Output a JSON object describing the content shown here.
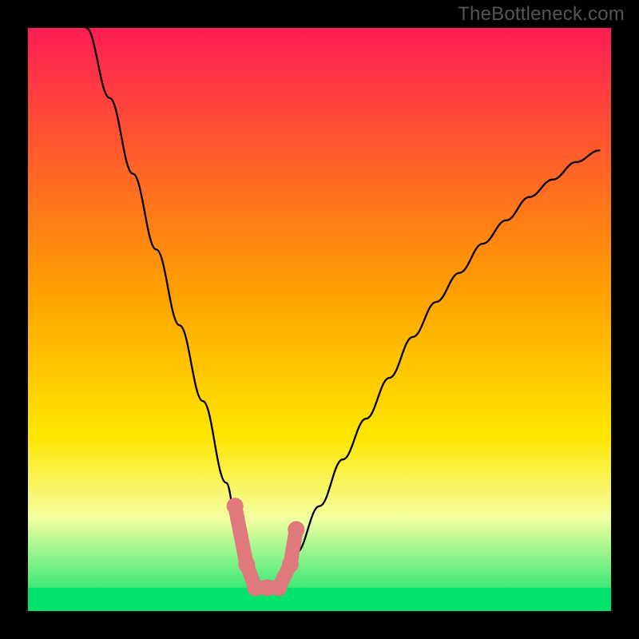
{
  "watermark": "TheBottleneck.com",
  "chart_data": {
    "type": "line",
    "title": "",
    "xlabel": "",
    "ylabel": "",
    "xlim": [
      0,
      100
    ],
    "ylim": [
      0,
      100
    ],
    "grid": false,
    "background_gradient": {
      "top": "#ff1d55",
      "mid": "#ffd200",
      "bottom": "#00e36b"
    },
    "series": [
      {
        "name": "bottleneck-curve",
        "color": "#000000",
        "x": [
          10,
          14,
          18,
          22,
          26,
          30,
          34,
          36,
          38,
          40,
          42,
          44,
          46,
          50,
          54,
          58,
          62,
          66,
          70,
          74,
          78,
          82,
          86,
          90,
          94,
          98
        ],
        "y": [
          100,
          88,
          75,
          62,
          49,
          36,
          22,
          14,
          8,
          4,
          4,
          6,
          10,
          18,
          26,
          33,
          40,
          47,
          53,
          58,
          63,
          67,
          71,
          74,
          77,
          79
        ]
      },
      {
        "name": "sweet-spot-marker",
        "color": "#e0797d",
        "kind": "marker-path",
        "points": [
          {
            "x": 35.5,
            "y": 18
          },
          {
            "x": 37.5,
            "y": 8
          },
          {
            "x": 39.0,
            "y": 4
          },
          {
            "x": 41.0,
            "y": 4
          },
          {
            "x": 43.0,
            "y": 4
          },
          {
            "x": 45.0,
            "y": 8
          },
          {
            "x": 46.0,
            "y": 14
          }
        ]
      }
    ],
    "green_band_y": [
      0,
      4
    ]
  }
}
